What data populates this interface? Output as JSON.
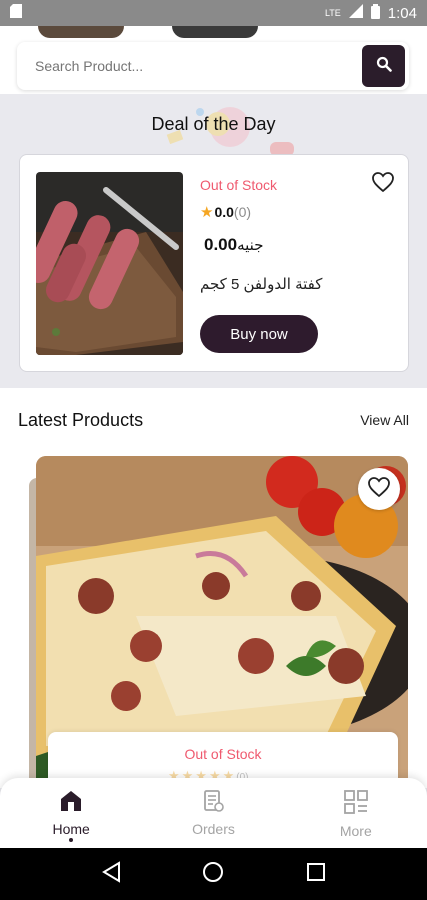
{
  "status_bar": {
    "time": "1:04",
    "lte": "LTE"
  },
  "search": {
    "placeholder": "Search Product..."
  },
  "deal": {
    "title": "Deal of the Day",
    "stock_status": "Out of Stock",
    "rating": "0.0",
    "rating_count": "(0)",
    "price": "0.00",
    "currency": "جنيه",
    "product_name": "كفتة الدولفن 5 كجم",
    "buy_label": "Buy now"
  },
  "latest": {
    "title": "Latest Products",
    "view_all": "View All",
    "product": {
      "stock_status": "Out of Stock",
      "stars": "★★★★★",
      "rating_count": "(0)"
    }
  },
  "bottom_nav": {
    "items": [
      {
        "label": "Home",
        "icon": "home-icon",
        "active": true
      },
      {
        "label": "Orders",
        "icon": "orders-icon",
        "active": false
      },
      {
        "label": "More",
        "icon": "grid-icon",
        "active": false
      }
    ]
  },
  "colors": {
    "primary": "#2e1b2d",
    "out_of_stock": "#ef5a6f",
    "star": "#f5a623",
    "background": "#e9e9ee"
  }
}
